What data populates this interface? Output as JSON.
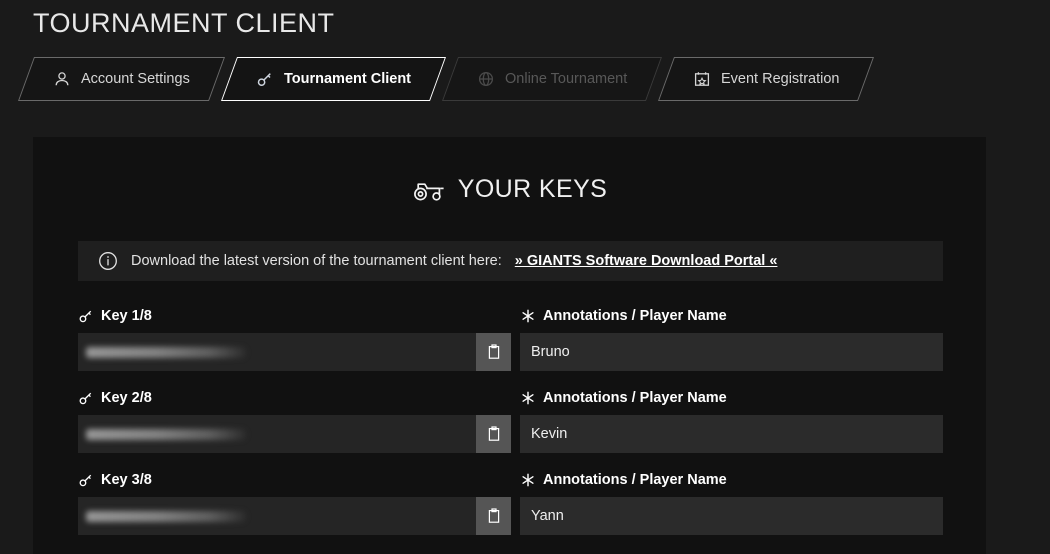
{
  "header": {
    "title": "TOURNAMENT CLIENT"
  },
  "tabs": [
    {
      "label": "Account Settings",
      "icon": "user-icon",
      "state": "normal"
    },
    {
      "label": "Tournament Client",
      "icon": "key-icon",
      "state": "active"
    },
    {
      "label": "Online Tournament",
      "icon": "globe-icon",
      "state": "disabled"
    },
    {
      "label": "Event Registration",
      "icon": "calendar-icon",
      "state": "normal"
    }
  ],
  "section": {
    "icon": "tractor-icon",
    "title": "YOUR KEYS"
  },
  "banner": {
    "icon": "info-icon",
    "text": "Download the latest version of the tournament client here:",
    "link_label": "» GIANTS Software Download Portal «"
  },
  "table": {
    "key_label_icon": "key-icon",
    "annotation_label_icon": "asterisk-icon",
    "annotation_header": "Annotations / Player Name",
    "copy_icon": "clipboard-icon",
    "rows": [
      {
        "key_label": "Key 1/8",
        "key_value": "",
        "annotation": "Bruno"
      },
      {
        "key_label": "Key 2/8",
        "key_value": "",
        "annotation": "Kevin"
      },
      {
        "key_label": "Key 3/8",
        "key_value": "",
        "annotation": "Yann"
      }
    ]
  },
  "colors": {
    "page_bg": "#1a1a1a",
    "panel_bg": "#111111",
    "banner_bg": "#1f1f1f",
    "field_bg": "#252525",
    "annotation_bg": "#2b2b2b",
    "copy_btn_bg": "#555555",
    "text": "#efefef",
    "active_border": "#ffffff",
    "disabled_text": "#585858"
  }
}
